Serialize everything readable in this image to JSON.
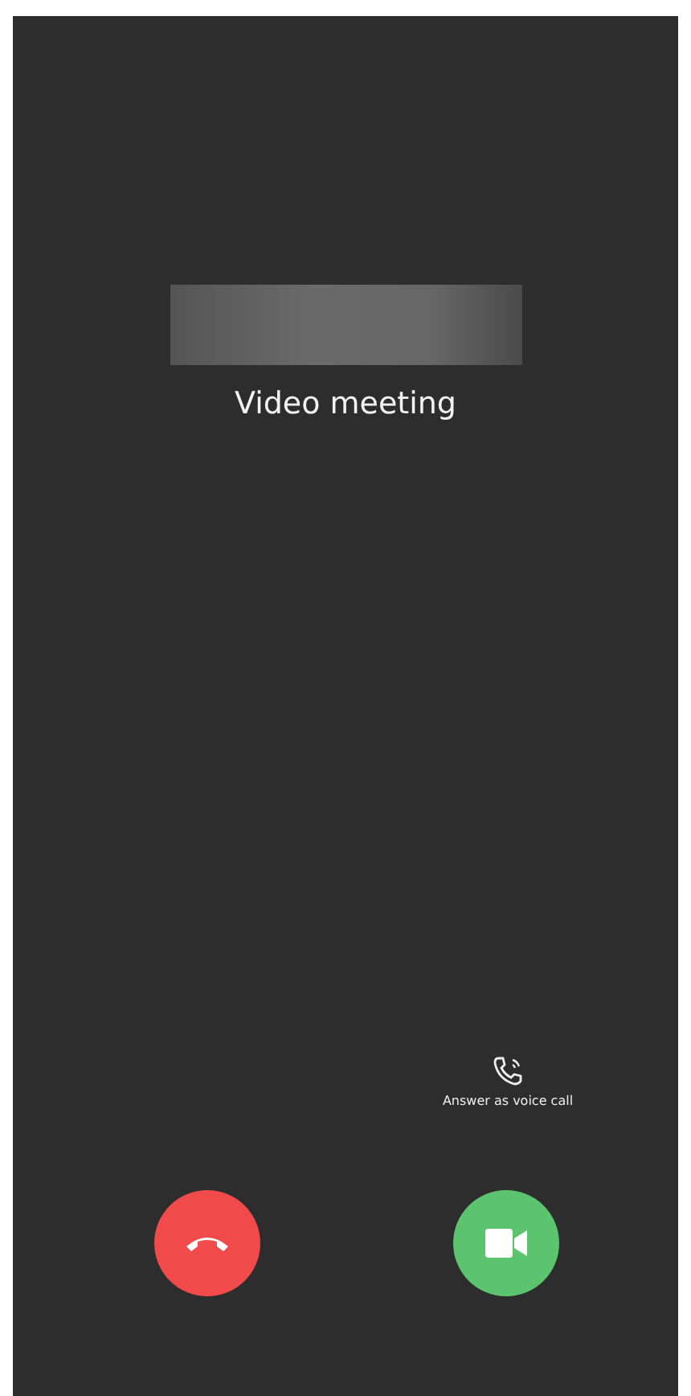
{
  "caller": {
    "subtitle": "Video meeting"
  },
  "voice_option": {
    "label": "Answer as voice call"
  },
  "actions": [
    {
      "kind": "decline",
      "color": "#f04a4a"
    },
    {
      "kind": "accept_video",
      "color": "#5cc46e"
    }
  ]
}
